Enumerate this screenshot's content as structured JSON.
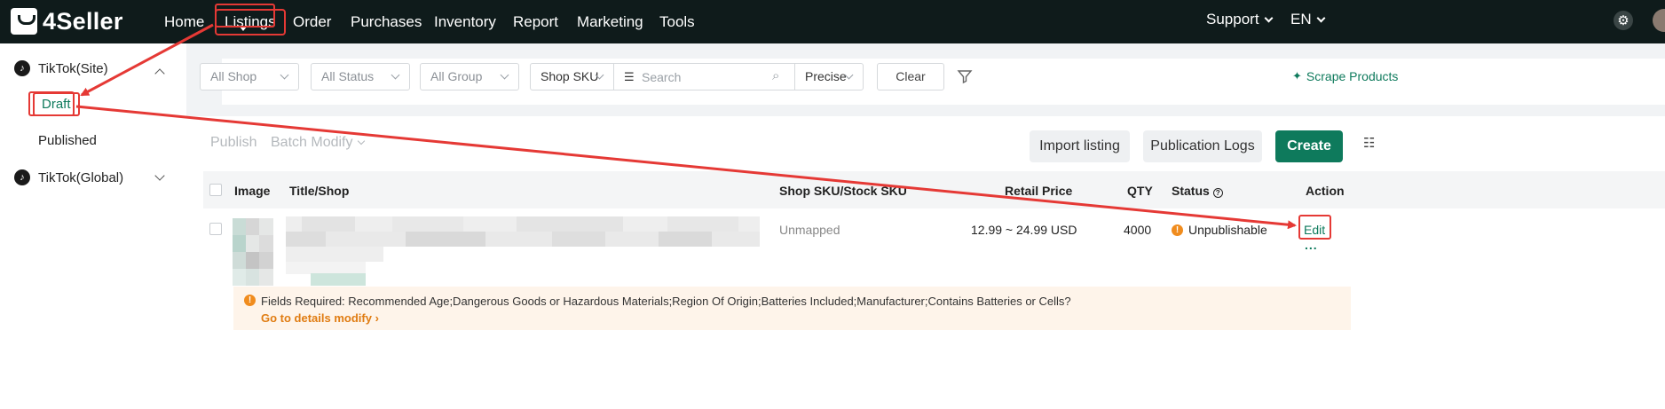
{
  "app": {
    "logo_text": "4Seller"
  },
  "nav": {
    "items": [
      "Home",
      "Listings",
      "Order",
      "Purchases",
      "Inventory",
      "Report",
      "Marketing",
      "Tools"
    ],
    "support": "Support",
    "language": "EN"
  },
  "sidebar": {
    "groups": [
      {
        "label": "TikTok(Site)",
        "expanded": true,
        "items": [
          "Draft",
          "Published"
        ]
      },
      {
        "label": "TikTok(Global)",
        "expanded": false,
        "items": []
      }
    ],
    "active_item": "Draft"
  },
  "filters": {
    "shop": "All Shop",
    "status": "All Status",
    "group": "All Group",
    "sku_type": "Shop SKU",
    "search_placeholder": "Search",
    "match": "Precise",
    "clear": "Clear",
    "scrape": "Scrape Products"
  },
  "toolbar": {
    "publish": "Publish",
    "batch_modify": "Batch Modify",
    "import": "Import listing",
    "logs": "Publication Logs",
    "create": "Create"
  },
  "table": {
    "headers": [
      "Image",
      "Title/Shop",
      "Shop SKU/Stock SKU",
      "Retail Price",
      "QTY",
      "Status",
      "Action"
    ],
    "rows": [
      {
        "sku": "Unmapped",
        "price": "12.99 ~ 24.99 USD",
        "qty": "4000",
        "status": "Unpublishable",
        "action": "Edit",
        "more": "..."
      }
    ],
    "warning": {
      "text": "Fields Required: Recommended Age;Dangerous Goods or Hazardous Materials;Region Of Origin;Batteries Included;Manufacturer;Contains Batteries or Cells?",
      "link": "Go to details modify"
    }
  },
  "colors": {
    "accent": "#0e7a5c",
    "annotation": "#e53935",
    "topbar": "#0f1b1b",
    "warning": "#f08c1e"
  }
}
